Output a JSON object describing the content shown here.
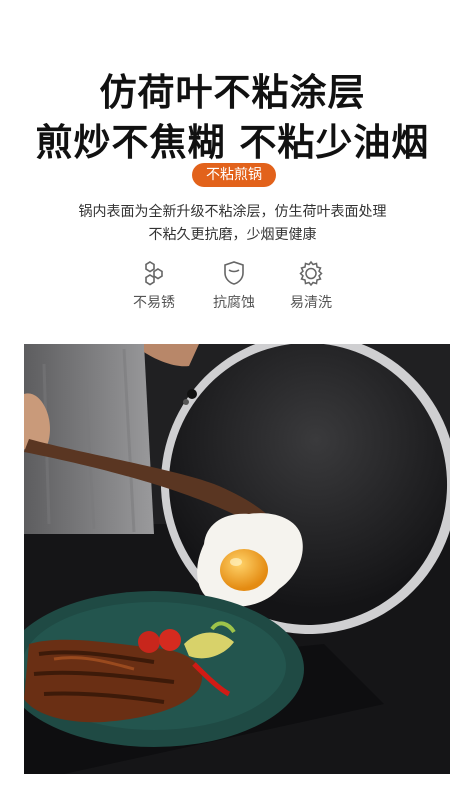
{
  "headline": {
    "line1": "仿荷叶不粘涂层",
    "line2": "煎炒不焦糊 不粘少油烟"
  },
  "tag": "不粘煎锅",
  "description": {
    "line1": "锅内表面为全新升级不粘涂层，仿生荷叶表面处理",
    "line2": "不粘久更抗磨，少烟更健康"
  },
  "features": [
    {
      "icon": "hexagon-cluster-icon",
      "label": "不易锈"
    },
    {
      "icon": "shield-icon",
      "label": "抗腐蚀"
    },
    {
      "icon": "gear-ring-icon",
      "label": "易清洗"
    }
  ],
  "colors": {
    "accent": "#e2621b",
    "text": "#111111",
    "plate": "#1f4a44"
  }
}
